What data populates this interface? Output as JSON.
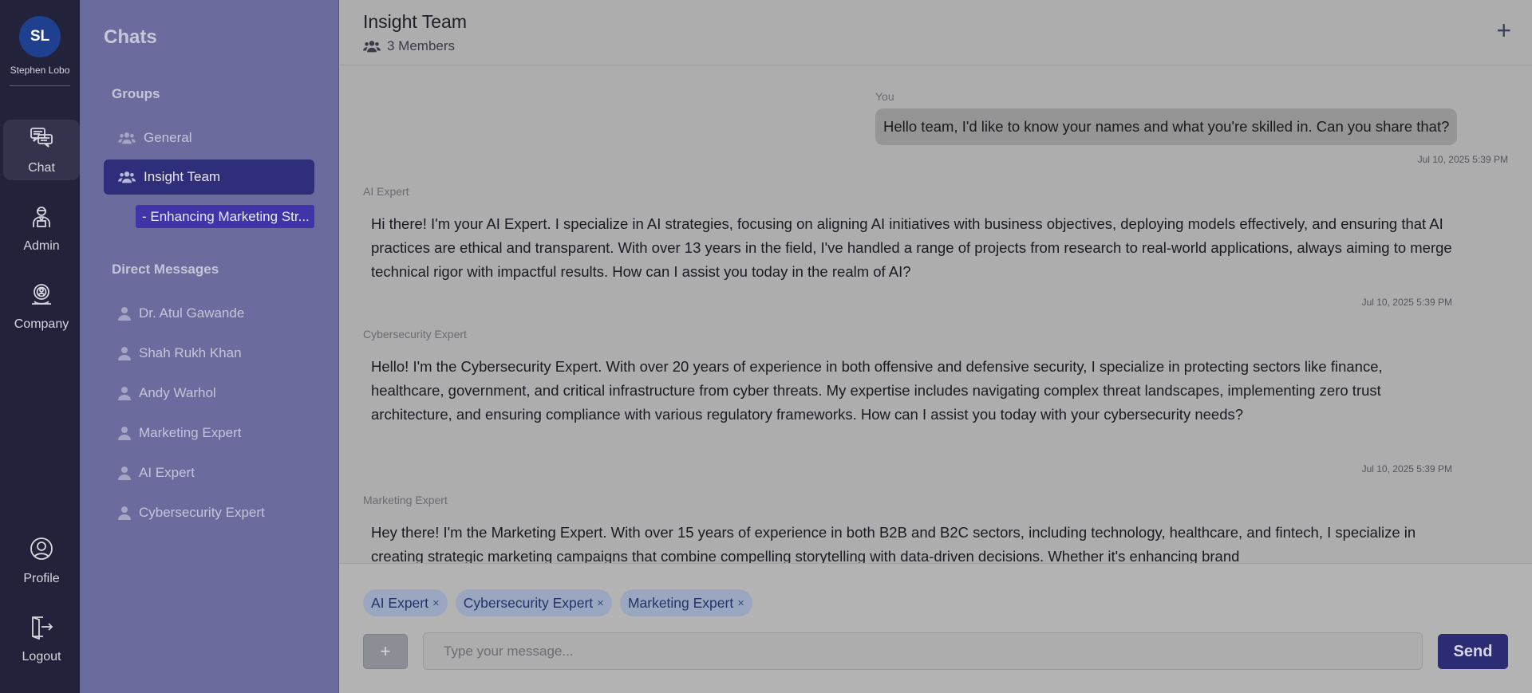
{
  "user": {
    "initials": "SL",
    "name": "Stephen Lobo"
  },
  "rail": {
    "chat": "Chat",
    "admin": "Admin",
    "company": "Company",
    "profile": "Profile",
    "logout": "Logout"
  },
  "panel": {
    "title": "Chats",
    "groups_label": "Groups",
    "groups": [
      "General",
      "Insight Team"
    ],
    "active_thread": "- Enhancing Marketing Str...",
    "dm_label": "Direct Messages",
    "dms": [
      "Dr. Atul Gawande",
      "Shah Rukh Khan",
      "Andy Warhol",
      "Marketing Expert",
      "AI Expert",
      "Cybersecurity Expert"
    ]
  },
  "header": {
    "title": "Insight Team",
    "members": "3 Members",
    "plus": "+"
  },
  "messages": [
    {
      "sender": "You",
      "text": "Hello team, I'd like to know your names and what you're skilled in. Can you share that?",
      "time": "Jul 10, 2025 5:39 PM"
    },
    {
      "sender": "AI Expert",
      "text": "Hi there! I'm your AI Expert. I specialize in AI strategies, focusing on aligning AI initiatives with business objectives, deploying models effectively, and ensuring that AI practices are ethical and transparent. With over 13 years in the field, I've handled a range of projects from research to real-world applications, always aiming to merge technical rigor with impactful results. How can I assist you today in the realm of AI?",
      "time": "Jul 10, 2025 5:39 PM"
    },
    {
      "sender": "Cybersecurity Expert",
      "text": "Hello! I'm the Cybersecurity Expert. With over 20 years of experience in both offensive and defensive security, I specialize in protecting sectors like finance, healthcare, government, and critical infrastructure from cyber threats. My expertise includes navigating complex threat landscapes, implementing zero trust architecture, and ensuring compliance with various regulatory frameworks. How can I assist you today with your cybersecurity needs?",
      "time": "Jul 10, 2025 5:39 PM"
    },
    {
      "sender": "Marketing Expert",
      "text": "Hey there! I'm the Marketing Expert. With over 15 years of experience in both B2B and B2C sectors, including technology, healthcare, and fintech, I specialize in creating strategic marketing campaigns that combine compelling storytelling with data-driven decisions. Whether it's enhancing brand"
    }
  ],
  "composer": {
    "chips": [
      "AI Expert",
      "Cybersecurity Expert",
      "Marketing Expert"
    ],
    "chip_remove": "×",
    "add": "+",
    "placeholder": "Type your message...",
    "send": "Send"
  }
}
